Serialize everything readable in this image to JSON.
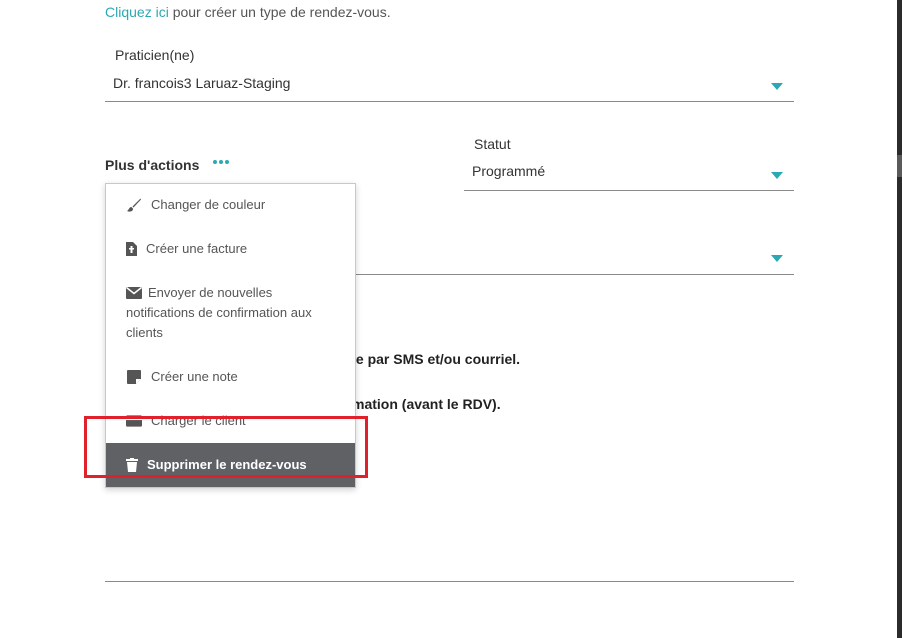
{
  "header": {
    "create_link": "Cliquez ici",
    "create_suffix": " pour créer un type de rendez-vous."
  },
  "practitioner": {
    "label": "Praticien(ne)",
    "value": "Dr. francois3 Laruaz-Staging"
  },
  "more_actions": {
    "label": "Plus d'actions"
  },
  "status": {
    "label": "Statut",
    "value": "Programmé"
  },
  "background_text": {
    "sms_line": "le par SMS et/ou courriel.",
    "confirmation_line": "mation (avant le RDV)."
  },
  "menu": {
    "items": [
      {
        "label": "Changer de couleur",
        "icon": "paintbrush-icon"
      },
      {
        "label": "Créer une facture",
        "icon": "invoice-icon"
      },
      {
        "label": "Envoyer de nouvelles notifications de confirmation aux clients",
        "icon": "envelope-icon"
      },
      {
        "label": "Créer une note",
        "icon": "note-icon"
      },
      {
        "label": "Charger le client",
        "icon": "credit-card-icon"
      },
      {
        "label": "Supprimer le rendez-vous",
        "icon": "trash-icon",
        "active": true
      }
    ]
  },
  "colors": {
    "accent": "#2aa9b4",
    "active_item_bg": "#606164",
    "highlight_border": "#e0202a"
  }
}
